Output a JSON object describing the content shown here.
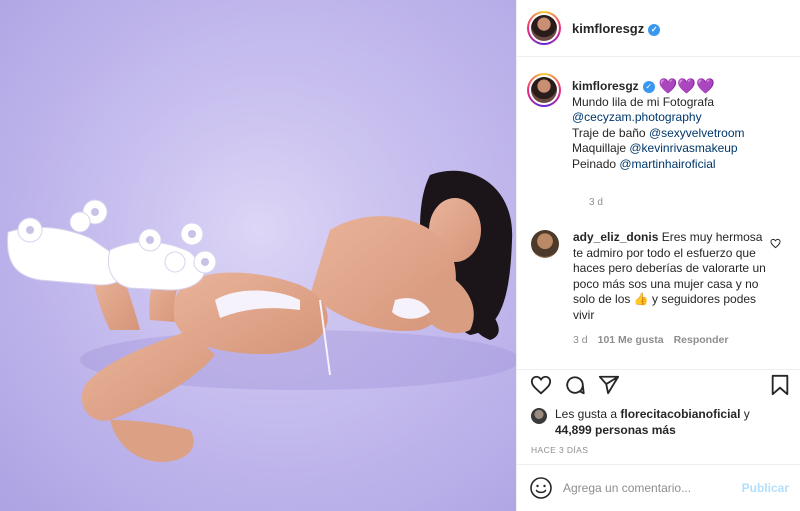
{
  "post": {
    "author": "kimfloresgz",
    "verified_mark": "✓",
    "photo_alt": "Photo of a woman in roller skates posing on a lilac background"
  },
  "caption": {
    "username": "kimfloresgz",
    "hearts": "💜💜💜",
    "line1": "Mundo lila de mi Fotografa",
    "line2_mention": "@cecyzam.photography",
    "line3_prefix": "Traje de baño ",
    "line3_mention": "@sexyvelvetroom",
    "line4_prefix": "Maquillaje ",
    "line4_mention": "@kevinrivasmakeup",
    "line5_prefix": "Peinado ",
    "line5_mention": "@martinhairoficial",
    "time": "3 d"
  },
  "comment": {
    "username": "ady_eliz_donis",
    "text": "Eres muy hermosa te admiro por todo el esfuerzo que haces pero deberías de valorarte un poco más sos una mujer casa y no solo de los 👍 y seguidores podes vivir",
    "time": "3 d",
    "likes": "101 Me gusta",
    "reply": "Responder"
  },
  "icons": {
    "like": "heart-icon",
    "comment": "comment-icon",
    "share": "share-icon",
    "save": "bookmark-icon",
    "emoji": "emoji-icon"
  },
  "likes": {
    "prefix": "Les gusta a ",
    "user": "florecitacobianoficial",
    "connector": " y",
    "count": "44,899 personas más"
  },
  "time_ago": "HACE 3 DÍAS",
  "comment_box": {
    "placeholder": "Agrega un comentario...",
    "post_label": "Publicar"
  },
  "colors": {
    "link": "#00376b",
    "verified": "#3897f0",
    "post_button": "#b2dffc",
    "photo_bg": "#c6bdef"
  }
}
